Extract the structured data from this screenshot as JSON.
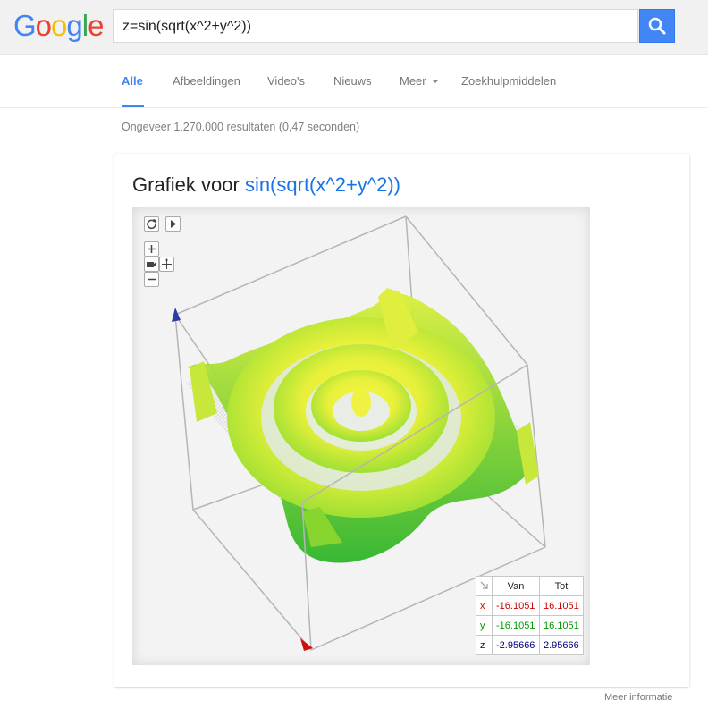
{
  "header": {
    "logo": "Google",
    "search_value": "z=sin(sqrt(x^2+y^2))"
  },
  "tabs": [
    {
      "label": "Alle",
      "active": true
    },
    {
      "label": "Afbeeldingen",
      "active": false
    },
    {
      "label": "Video's",
      "active": false
    },
    {
      "label": "Nieuws",
      "active": false
    },
    {
      "label": "Meer",
      "active": false
    },
    {
      "label": "Zoekhulpmiddelen",
      "active": false
    }
  ],
  "results_stats": "Ongeveer 1.270.000 resultaten (0,47 seconden)",
  "card": {
    "title_prefix": "Grafiek voor ",
    "function": "sin(sqrt(x^2+y^2))",
    "range_table": {
      "col_from": "Van",
      "col_to": "Tot",
      "rows": [
        {
          "axis": "x",
          "from": "-16.1051",
          "to": "16.1051",
          "color": "#cc0000"
        },
        {
          "axis": "y",
          "from": "-16.1051",
          "to": "16.1051",
          "color": "#009900"
        },
        {
          "axis": "z",
          "from": "-2.95666",
          "to": "2.95666",
          "color": "#000080"
        }
      ]
    }
  },
  "more_info": "Meer informatie",
  "colors": {
    "accent": "#4285f4",
    "surface_yellow": "#f2f23a",
    "surface_green": "#4fcf2f"
  }
}
